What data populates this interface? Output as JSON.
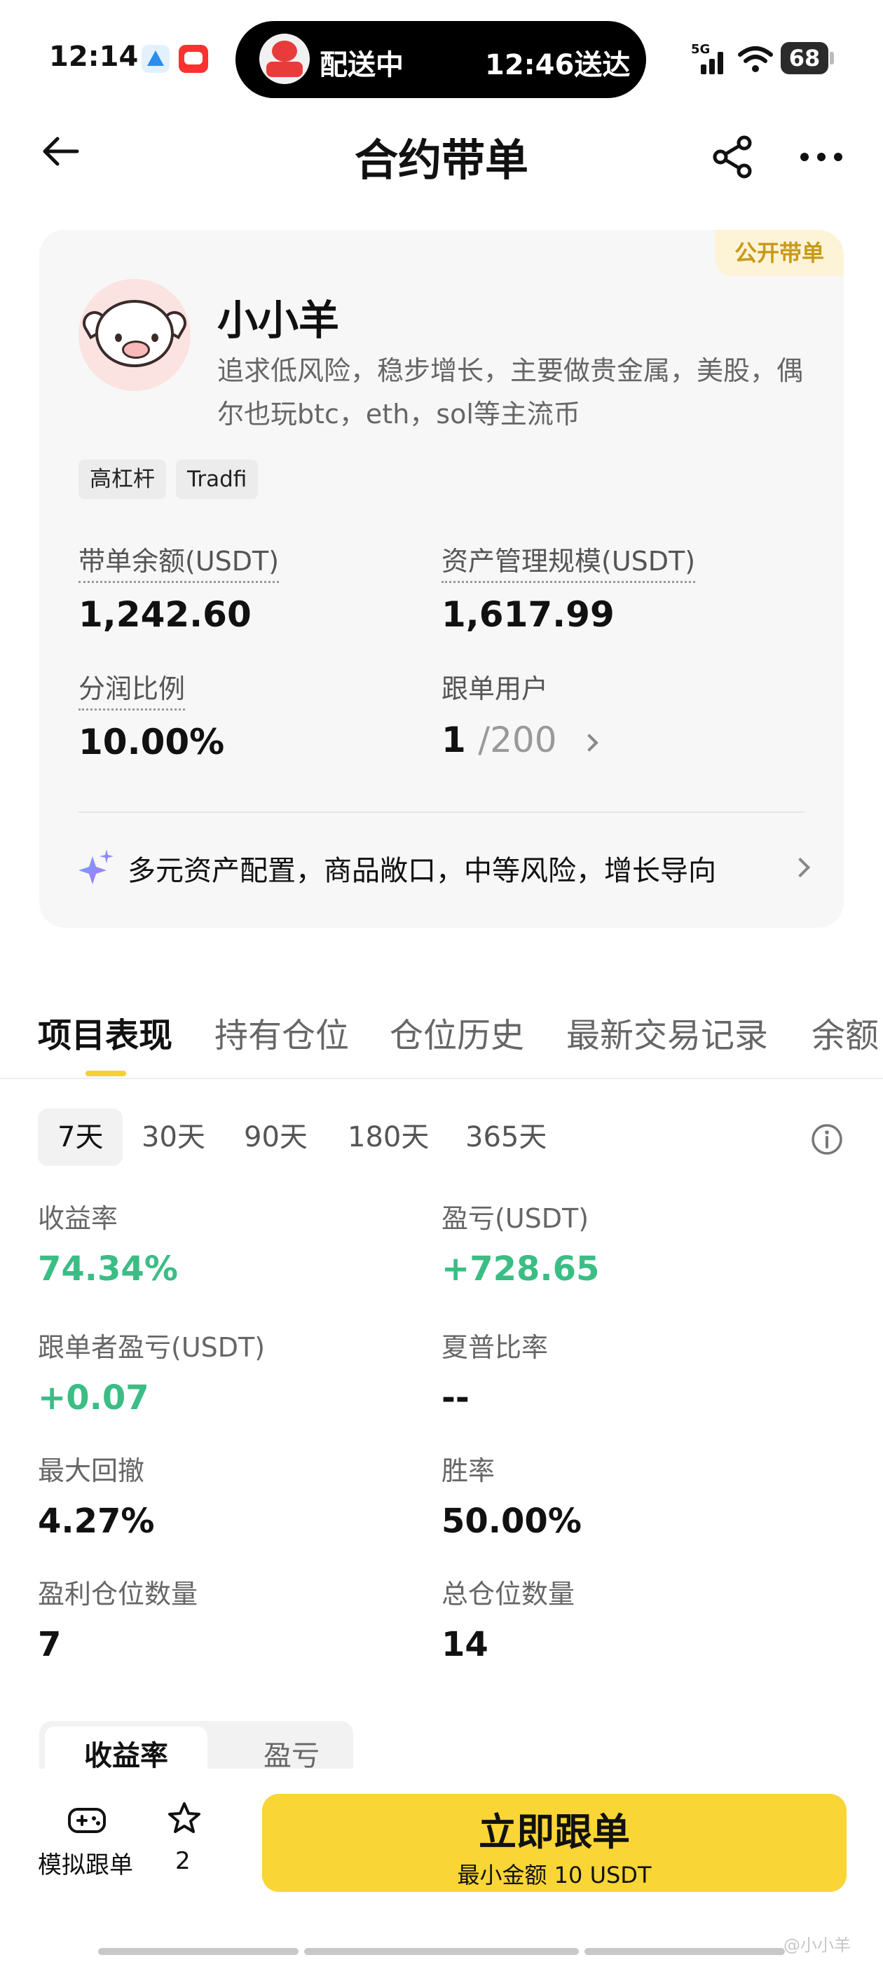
{
  "status_bar": {
    "time": "12:14",
    "delivery_status": "配送中",
    "delivery_eta": "12:46送达",
    "network": "5G",
    "battery": "68"
  },
  "header": {
    "title": "合约带单"
  },
  "profile": {
    "badge": "公开带单",
    "nickname": "小小羊",
    "bio": "追求低风险，稳步增长，主要做贵金属，美股，偶尔也玩btc，eth，sol等主流币",
    "tags": [
      "高杠杆",
      "Tradfi"
    ],
    "stats": {
      "balance_label": "带单余额(USDT)",
      "balance_value": "1,242.60",
      "aum_label": "资产管理规模(USDT)",
      "aum_value": "1,617.99",
      "share_label": "分润比例",
      "share_value": "10.00%",
      "followers_label": "跟单用户",
      "followers_current": "1",
      "followers_total": "/200"
    },
    "summary": "多元资产配置，商品敞口，中等风险，增长导向"
  },
  "tabs": [
    "项目表现",
    "持有仓位",
    "仓位历史",
    "最新交易记录",
    "余额"
  ],
  "periods": [
    "7天",
    "30天",
    "90天",
    "180天",
    "365天"
  ],
  "metrics": {
    "roi_label": "收益率",
    "roi_value": "74.34%",
    "pnl_label": "盈亏(USDT)",
    "pnl_value": "+728.65",
    "copier_pnl_label": "跟单者盈亏(USDT)",
    "copier_pnl_value": "+0.07",
    "sharpe_label": "夏普比率",
    "sharpe_value": "--",
    "drawdown_label": "最大回撤",
    "drawdown_value": "4.27%",
    "winrate_label": "胜率",
    "winrate_value": "50.00%",
    "profit_positions_label": "盈利仓位数量",
    "profit_positions_value": "7",
    "total_positions_label": "总仓位数量",
    "total_positions_value": "14"
  },
  "chart_toggle": [
    "收益率",
    "盈亏"
  ],
  "bottom_bar": {
    "demo_label": "模拟跟单",
    "favorites_count": "2",
    "follow_button": "立即跟单",
    "follow_min": "最小金额 10 USDT"
  },
  "watermark": "@小小羊",
  "colors": {
    "accent_yellow": "#f9d536",
    "positive_green": "#3bbd85",
    "badge_text": "#c89a1a"
  }
}
